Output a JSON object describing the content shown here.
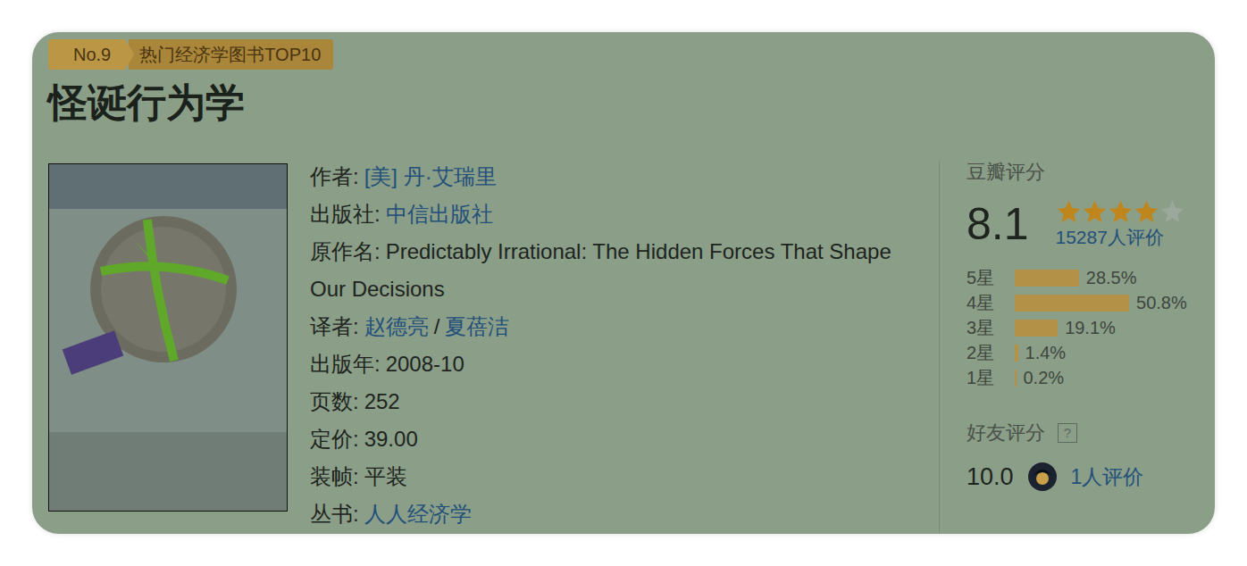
{
  "badge": {
    "rank": "No.9",
    "label": "热门经济学图书TOP10"
  },
  "title": "怪诞行为学",
  "info": [
    {
      "label": "作者:",
      "segments": [
        {
          "text": "[美] 丹·艾瑞里",
          "link": true
        }
      ]
    },
    {
      "label": "出版社:",
      "segments": [
        {
          "text": "中信出版社",
          "link": true
        }
      ]
    },
    {
      "label": "原作名:",
      "segments": [
        {
          "text": "Predictably Irrational: The Hidden Forces That Shape Our Decisions",
          "link": false
        }
      ]
    },
    {
      "label": "译者:",
      "segments": [
        {
          "text": "赵德亮",
          "link": true
        },
        {
          "text": "/",
          "link": false
        },
        {
          "text": "夏蓓洁",
          "link": true
        }
      ]
    },
    {
      "label": "出版年:",
      "segments": [
        {
          "text": "2008-10",
          "link": false
        }
      ]
    },
    {
      "label": "页数:",
      "segments": [
        {
          "text": "252",
          "link": false
        }
      ]
    },
    {
      "label": "定价:",
      "segments": [
        {
          "text": "39.00",
          "link": false
        }
      ]
    },
    {
      "label": "装帧:",
      "segments": [
        {
          "text": "平装",
          "link": false
        }
      ]
    },
    {
      "label": "丛书:",
      "segments": [
        {
          "text": "人人经济学",
          "link": true
        }
      ]
    }
  ],
  "rating": {
    "title": "豆瓣评分",
    "score": "8.1",
    "stars": 4,
    "star_slots": 5,
    "count": "15287人评价",
    "distribution": [
      {
        "label": "5星",
        "share": "28.5%",
        "level": 0.285
      },
      {
        "label": "4星",
        "share": "50.8%",
        "level": 0.508
      },
      {
        "label": "3星",
        "share": "19.1%",
        "level": 0.191
      },
      {
        "label": "2星",
        "share": "1.4%",
        "level": 0.014
      },
      {
        "label": "1星",
        "share": "0.2%",
        "level": 0.002
      }
    ]
  },
  "friends": {
    "title": "好友评分",
    "help": "?",
    "score": "10.0",
    "count": "1人评价"
  }
}
